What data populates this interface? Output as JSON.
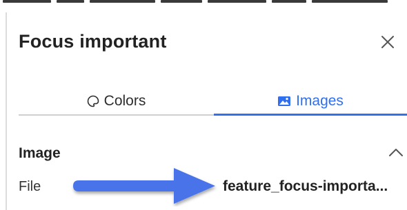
{
  "panel": {
    "title": "Focus important"
  },
  "close_icon": "close-icon",
  "tabs": [
    {
      "label": "Colors",
      "icon": "palette-icon",
      "active": false
    },
    {
      "label": "Images",
      "icon": "image-icon",
      "active": true
    }
  ],
  "section": {
    "title": "Image",
    "icon": "chevron-up-icon",
    "rows": [
      {
        "label": "File",
        "value": "feature_focus-importa..."
      }
    ]
  },
  "annotation": {
    "icon": "arrow-right-icon",
    "color": "#4a73e8"
  },
  "colors": {
    "accent": "#2f6ff0",
    "text": "#222222",
    "divider": "#cfcfcf"
  }
}
